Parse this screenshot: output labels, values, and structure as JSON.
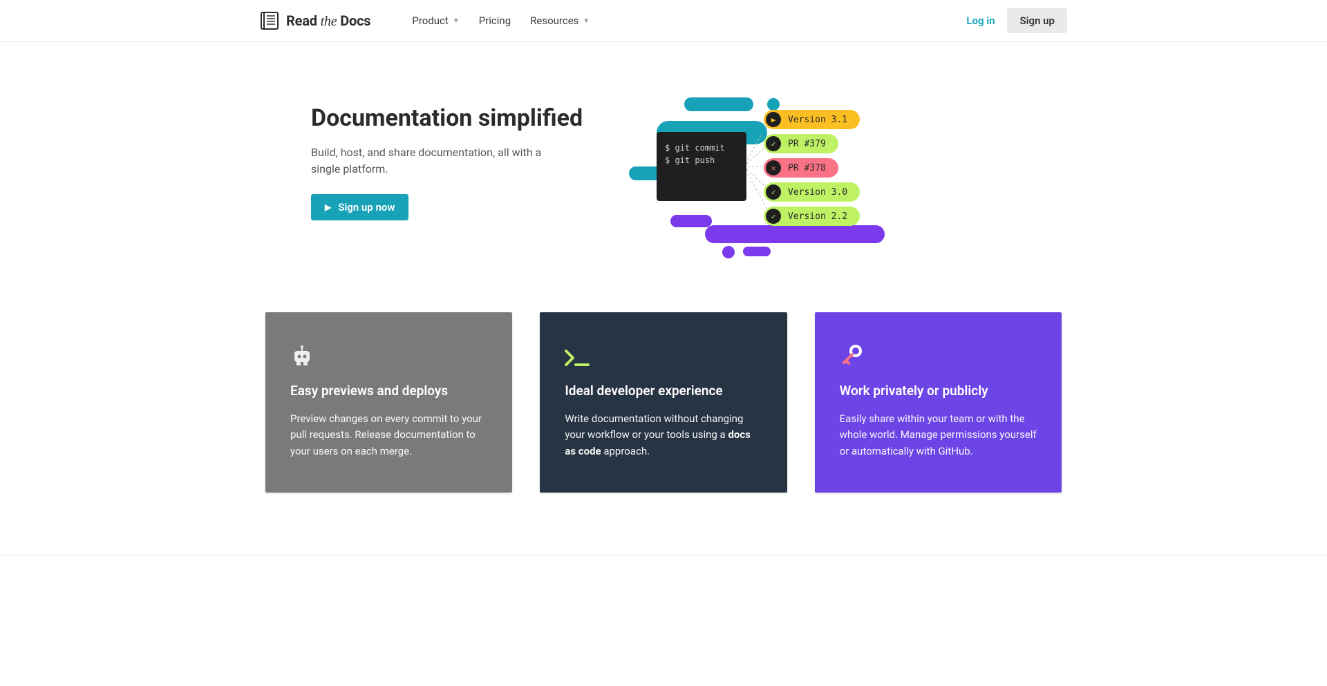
{
  "brand": {
    "name_a": "Read",
    "name_b": "the",
    "name_c": "Docs"
  },
  "nav": {
    "product": "Product",
    "pricing": "Pricing",
    "resources": "Resources"
  },
  "auth": {
    "login": "Log in",
    "signup": "Sign up"
  },
  "hero": {
    "title": "Documentation simplified",
    "subtitle": "Build, host, and share documentation, all with a single platform.",
    "cta": "Sign up now",
    "terminal": {
      "l1": "$ git commit",
      "l2": "$ git push"
    },
    "pills": [
      {
        "text": "Version 3.1",
        "tone": "yellow",
        "icon": "play"
      },
      {
        "text": "PR #379",
        "tone": "lime",
        "icon": "check"
      },
      {
        "text": "PR #378",
        "tone": "red",
        "icon": "x"
      },
      {
        "text": "Version 3.0",
        "tone": "lime",
        "icon": "check"
      },
      {
        "text": "Version 2.2",
        "tone": "lime",
        "icon": "check"
      }
    ]
  },
  "features": [
    {
      "title": "Easy previews and deploys",
      "body": "Preview changes on every commit to your pull requests. Release documentation to your users on each merge."
    },
    {
      "title": "Ideal developer experience",
      "body_pre": "Write documentation without changing your workflow or your tools using a ",
      "body_bold": "docs as code",
      "body_post": " approach."
    },
    {
      "title": "Work privately or publicly",
      "body": "Easily share within your team or with the whole world. Manage permissions yourself or automatically with GitHub."
    }
  ]
}
